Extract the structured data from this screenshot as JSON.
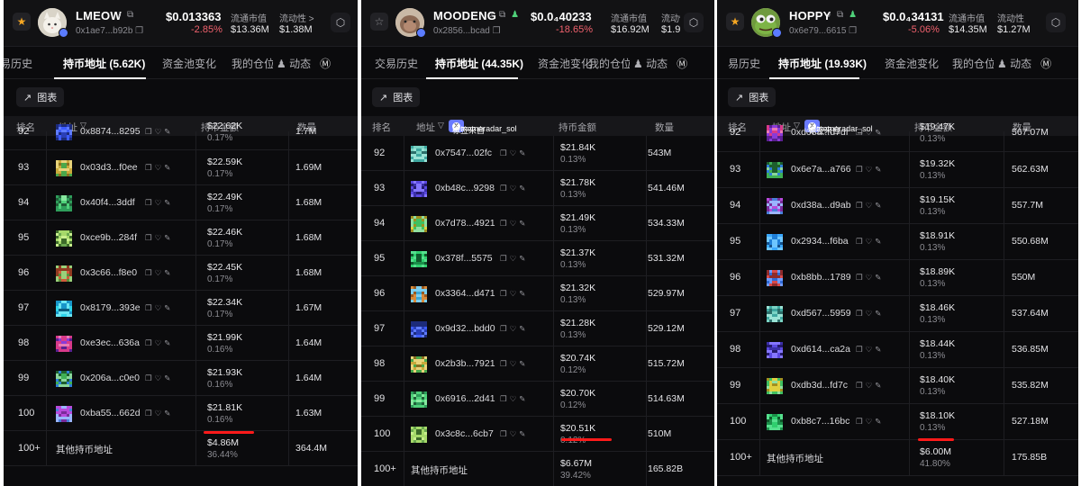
{
  "tag_text": "标签来自",
  "tag_source": "@memeradar_sol",
  "chart_button_label": "图表",
  "panels": [
    {
      "token_name": "LMEOW",
      "token_addr": "0x1ae7...b92b",
      "price": "$0.013363",
      "change": "-2.85%",
      "mcap_label": "流通市值",
      "mcap_value": "$13.36M",
      "liq_label": "流动性 >",
      "liq_value": "$1.38M",
      "tabs": [
        "易历史",
        "持币地址 (5.62K)",
        "资金池变化",
        "我的仓位",
        "动态"
      ],
      "headers": {
        "rank": "排名",
        "address": "地址",
        "amount": "持币金额",
        "qty": "数量"
      },
      "rows": [
        {
          "rank": "92",
          "addr": "0x8874...8295",
          "amt": "$22.62K",
          "pct": "0.17%",
          "qty": "1.7M"
        },
        {
          "rank": "93",
          "addr": "0x03d3...f0ee",
          "amt": "$22.59K",
          "pct": "0.17%",
          "qty": "1.69M"
        },
        {
          "rank": "94",
          "addr": "0x40f4...3ddf",
          "amt": "$22.49K",
          "pct": "0.17%",
          "qty": "1.68M"
        },
        {
          "rank": "95",
          "addr": "0xce9b...284f",
          "amt": "$22.46K",
          "pct": "0.17%",
          "qty": "1.68M"
        },
        {
          "rank": "96",
          "addr": "0x3c66...f8e0",
          "amt": "$22.45K",
          "pct": "0.17%",
          "qty": "1.68M"
        },
        {
          "rank": "97",
          "addr": "0x8179...393e",
          "amt": "$22.34K",
          "pct": "0.17%",
          "qty": "1.67M"
        },
        {
          "rank": "98",
          "addr": "0xe3ec...636a",
          "amt": "$21.99K",
          "pct": "0.16%",
          "qty": "1.64M"
        },
        {
          "rank": "99",
          "addr": "0x206a...c0e0",
          "amt": "$21.93K",
          "pct": "0.16%",
          "qty": "1.64M"
        },
        {
          "rank": "100",
          "addr": "0xba55...662d",
          "amt": "$21.81K",
          "pct": "0.16%",
          "qty": "1.63M"
        },
        {
          "rank": "100+",
          "addr": "其他持币地址",
          "amt": "$4.86M",
          "pct": "36.44%",
          "qty": "364.4M"
        }
      ]
    },
    {
      "token_name": "MOODENG",
      "token_addr": "0x2856...bcad",
      "price": "$0.0₄40233",
      "change": "-18.65%",
      "mcap_label": "流通市值",
      "mcap_value": "$16.92M",
      "liq_label": "流动性",
      "liq_value": "$1.97M",
      "tabs": [
        "交易历史",
        "持币地址 (44.35K)",
        "资金池变化",
        "我的仓位",
        "动态"
      ],
      "headers": {
        "rank": "排名",
        "address": "地址",
        "amount": "持币金额",
        "qty": "数量"
      },
      "rows": [
        {
          "rank": "92",
          "addr": "0x7547...02fc",
          "amt": "$21.84K",
          "pct": "0.13%",
          "qty": "543M"
        },
        {
          "rank": "93",
          "addr": "0xb48c...9298",
          "amt": "$21.78K",
          "pct": "0.13%",
          "qty": "541.46M"
        },
        {
          "rank": "94",
          "addr": "0x7d78...4921",
          "amt": "$21.49K",
          "pct": "0.13%",
          "qty": "534.33M"
        },
        {
          "rank": "95",
          "addr": "0x378f...5575",
          "amt": "$21.37K",
          "pct": "0.13%",
          "qty": "531.32M"
        },
        {
          "rank": "96",
          "addr": "0x3364...d471",
          "amt": "$21.32K",
          "pct": "0.13%",
          "qty": "529.97M"
        },
        {
          "rank": "97",
          "addr": "0x9d32...bdd0",
          "amt": "$21.28K",
          "pct": "0.13%",
          "qty": "529.12M"
        },
        {
          "rank": "98",
          "addr": "0x2b3b...7921",
          "amt": "$20.74K",
          "pct": "0.12%",
          "qty": "515.72M"
        },
        {
          "rank": "99",
          "addr": "0x6916...2d41",
          "amt": "$20.70K",
          "pct": "0.12%",
          "qty": "514.63M"
        },
        {
          "rank": "100",
          "addr": "0x3c8c...6cb7",
          "amt": "$20.51K",
          "pct": "0.12%",
          "qty": "510M"
        },
        {
          "rank": "100+",
          "addr": "其他持币地址",
          "amt": "$6.67M",
          "pct": "39.42%",
          "qty": "165.82B"
        }
      ]
    },
    {
      "token_name": "HOPPY",
      "token_addr": "0x6e79...6615",
      "price": "$0.0₄34131",
      "change": "-5.06%",
      "mcap_label": "流通市值",
      "mcap_value": "$14.35M",
      "liq_label": "流动性",
      "liq_value": "$1.27M",
      "tabs": [
        "易历史",
        "持币地址 (19.93K)",
        "资金池变化",
        "我的仓位",
        "动态"
      ],
      "headers": {
        "rank": "排名",
        "address": "地址",
        "amount": "持币金额",
        "qty": "数量"
      },
      "rows": [
        {
          "rank": "92",
          "addr": "0xd08a...d7df",
          "amt": "$19.47K",
          "pct": "0.13%",
          "qty": "567.07M"
        },
        {
          "rank": "93",
          "addr": "0x6e7a...a766",
          "amt": "$19.32K",
          "pct": "0.13%",
          "qty": "562.63M"
        },
        {
          "rank": "94",
          "addr": "0xd38a...d9ab",
          "amt": "$19.15K",
          "pct": "0.13%",
          "qty": "557.7M"
        },
        {
          "rank": "95",
          "addr": "0x2934...f6ba",
          "amt": "$18.91K",
          "pct": "0.13%",
          "qty": "550.68M"
        },
        {
          "rank": "96",
          "addr": "0xb8bb...1789",
          "amt": "$18.89K",
          "pct": "0.13%",
          "qty": "550M"
        },
        {
          "rank": "97",
          "addr": "0xd567...5959",
          "amt": "$18.46K",
          "pct": "0.13%",
          "qty": "537.64M"
        },
        {
          "rank": "98",
          "addr": "0xd614...ca2a",
          "amt": "$18.44K",
          "pct": "0.13%",
          "qty": "536.85M"
        },
        {
          "rank": "99",
          "addr": "0xdb3d...fd7c",
          "amt": "$18.40K",
          "pct": "0.13%",
          "qty": "535.82M"
        },
        {
          "rank": "100",
          "addr": "0xb8c7...16bc",
          "amt": "$18.10K",
          "pct": "0.13%",
          "qty": "527.18M"
        },
        {
          "rank": "100+",
          "addr": "其他持币地址",
          "amt": "$6.00M",
          "pct": "41.80%",
          "qty": "175.85B"
        }
      ]
    }
  ],
  "colors": {
    "background": "#0b0b0d",
    "negative": "#f0616d",
    "tag": "#6b7bff",
    "highlight": "#ff1a1a"
  }
}
